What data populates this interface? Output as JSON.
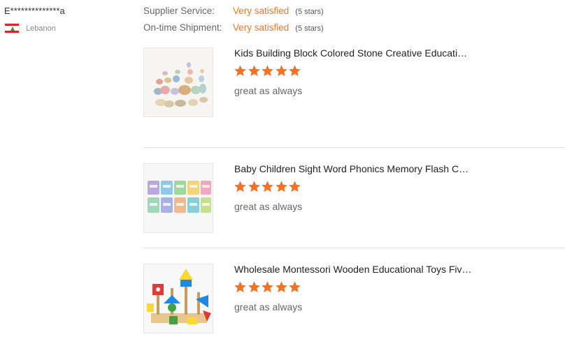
{
  "reviewer": {
    "name": "E**************a",
    "country": "Lebanon"
  },
  "ratings": [
    {
      "label": "Supplier Service:",
      "value": "Very satisfied",
      "stars": "(5 stars)"
    },
    {
      "label": "On-time Shipment:",
      "value": "Very satisfied",
      "stars": "(5 stars)"
    }
  ],
  "reviews": [
    {
      "title": "Kids Building Block Colored Stone Creative Education...",
      "rating": 5,
      "comment": "great as always"
    },
    {
      "title": "Baby Children Sight Word Phonics Memory Flash Car...",
      "rating": 5,
      "comment": "great as always"
    },
    {
      "title": "Wholesale Montessori Wooden Educational Toys Five ...",
      "rating": 5,
      "comment": "great as always"
    }
  ],
  "colors": {
    "accent": "#f57224",
    "star": "#f57224"
  }
}
